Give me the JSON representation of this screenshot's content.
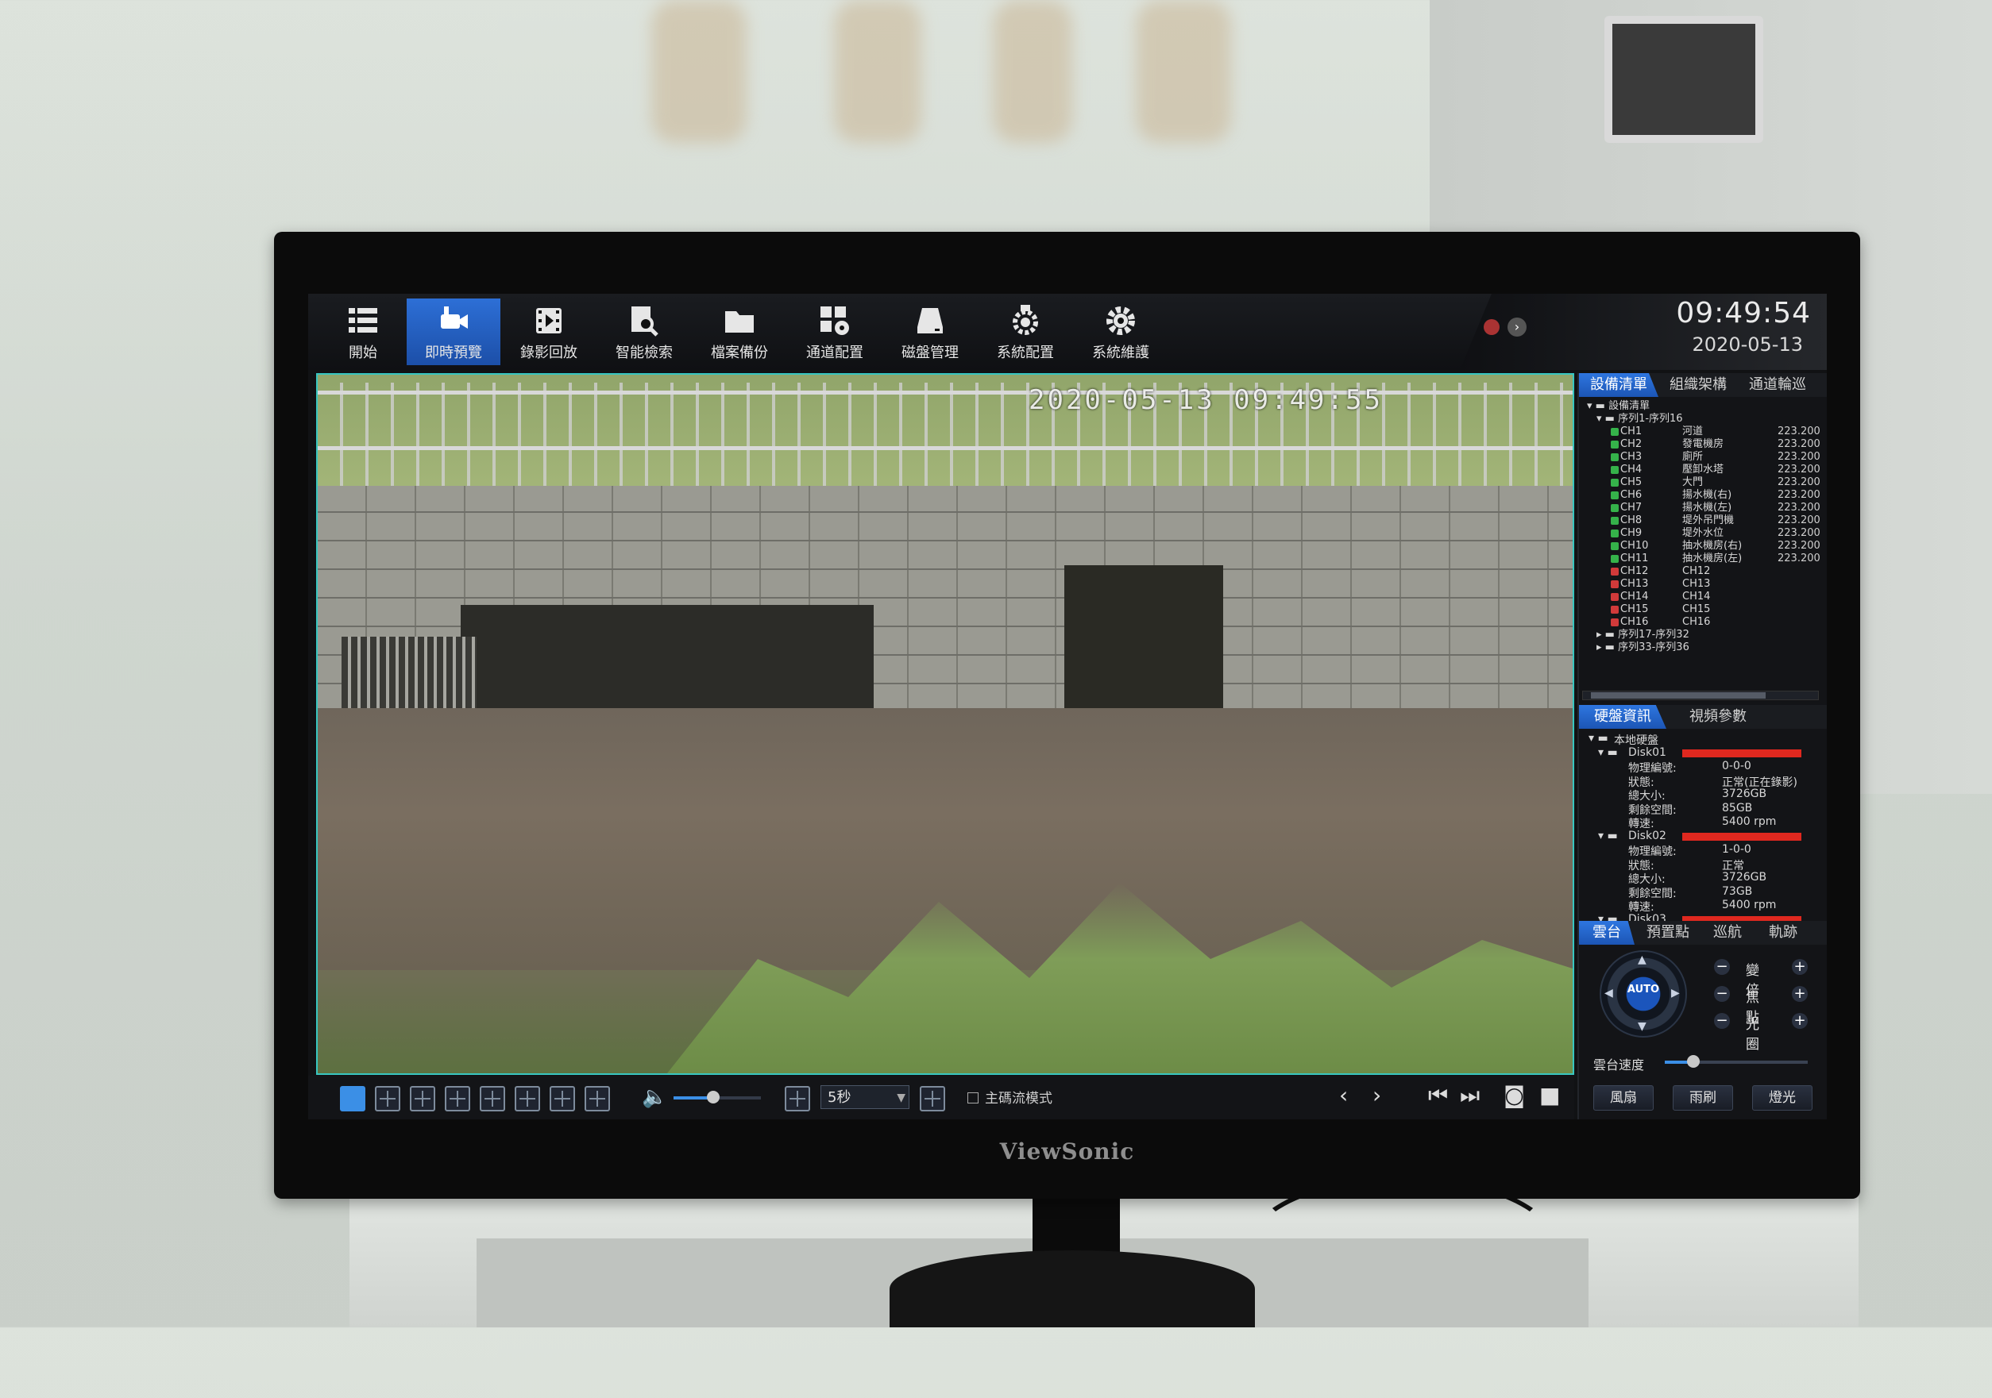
{
  "toolbar": {
    "items": [
      {
        "label": "開始",
        "icon": "menu-list-icon"
      },
      {
        "label": "即時預覽",
        "icon": "live-camera-icon",
        "active": true
      },
      {
        "label": "錄影回放",
        "icon": "film-playback-icon"
      },
      {
        "label": "智能檢索",
        "icon": "document-search-icon"
      },
      {
        "label": "檔案備份",
        "icon": "folder-icon"
      },
      {
        "label": "通道配置",
        "icon": "channel-config-icon"
      },
      {
        "label": "磁盤管理",
        "icon": "disk-icon"
      },
      {
        "label": "系統配置",
        "icon": "system-gear-camera-icon"
      },
      {
        "label": "系統維護",
        "icon": "gear-icon"
      }
    ]
  },
  "clock": {
    "time": "09:49:54",
    "date": "2020-05-13"
  },
  "camera_view": {
    "timestamp_overlay": "2020-05-13 09:49:55",
    "border_color": "#38c6c0"
  },
  "device_panel": {
    "tabs": [
      "設備清單",
      "組織架構",
      "通道輪巡"
    ],
    "root": "設備清單",
    "group_open": "序列1-序列16",
    "channels": [
      {
        "id": "CH1",
        "name": "河道",
        "ip": "223.200",
        "online": true
      },
      {
        "id": "CH2",
        "name": "發電機房",
        "ip": "223.200",
        "online": true
      },
      {
        "id": "CH3",
        "name": "廁所",
        "ip": "223.200",
        "online": true
      },
      {
        "id": "CH4",
        "name": "壓卸水塔",
        "ip": "223.200",
        "online": true
      },
      {
        "id": "CH5",
        "name": "大門",
        "ip": "223.200",
        "online": true
      },
      {
        "id": "CH6",
        "name": "揚水機(右)",
        "ip": "223.200",
        "online": true
      },
      {
        "id": "CH7",
        "name": "揚水機(左)",
        "ip": "223.200",
        "online": true
      },
      {
        "id": "CH8",
        "name": "堤外吊門機",
        "ip": "223.200",
        "online": true
      },
      {
        "id": "CH9",
        "name": "堤外水位",
        "ip": "223.200",
        "online": true
      },
      {
        "id": "CH10",
        "name": "抽水機房(右)",
        "ip": "223.200",
        "online": true
      },
      {
        "id": "CH11",
        "name": "抽水機房(左)",
        "ip": "223.200",
        "online": true
      },
      {
        "id": "CH12",
        "name": "CH12",
        "ip": "",
        "online": false
      },
      {
        "id": "CH13",
        "name": "CH13",
        "ip": "",
        "online": false
      },
      {
        "id": "CH14",
        "name": "CH14",
        "ip": "",
        "online": false
      },
      {
        "id": "CH15",
        "name": "CH15",
        "ip": "",
        "online": false
      },
      {
        "id": "CH16",
        "name": "CH16",
        "ip": "",
        "online": false
      }
    ],
    "groups_closed": [
      "序列17-序列32",
      "序列33-序列36"
    ]
  },
  "disk_panel": {
    "tabs": [
      "硬盤資訊",
      "視頻參數"
    ],
    "root": "本地硬盤",
    "disks": [
      {
        "name": "Disk01",
        "rows": [
          {
            "key": "物理編號:",
            "value": "0-0-0"
          },
          {
            "key": "狀態:",
            "value": "正常(正在錄影)"
          },
          {
            "key": "總大小:",
            "value": "3726GB"
          },
          {
            "key": "剩餘空間:",
            "value": "85GB"
          },
          {
            "key": "轉速:",
            "value": "5400 rpm"
          }
        ]
      },
      {
        "name": "Disk02",
        "rows": [
          {
            "key": "物理編號:",
            "value": "1-0-0"
          },
          {
            "key": "狀態:",
            "value": "正常"
          },
          {
            "key": "總大小:",
            "value": "3726GB"
          },
          {
            "key": "剩餘空間:",
            "value": "73GB"
          },
          {
            "key": "轉速:",
            "value": "5400 rpm"
          }
        ]
      },
      {
        "name": "Disk03",
        "rows": []
      }
    ]
  },
  "ptz_panel": {
    "tabs": [
      "雲台",
      "預置點",
      "巡航",
      "軌跡"
    ],
    "auto_label": "AUTO",
    "controls": [
      "變倍",
      "焦點",
      "光圈"
    ],
    "speed_label": "雲台速度",
    "speed_level": 0.2,
    "buttons": [
      "風扇",
      "雨刷",
      "燈光"
    ]
  },
  "bottom_bar": {
    "interval": "5秒",
    "mainstream_label": "主碼流模式",
    "volume_level": 0.45
  },
  "monitor": {
    "brand": "ViewSonic"
  }
}
